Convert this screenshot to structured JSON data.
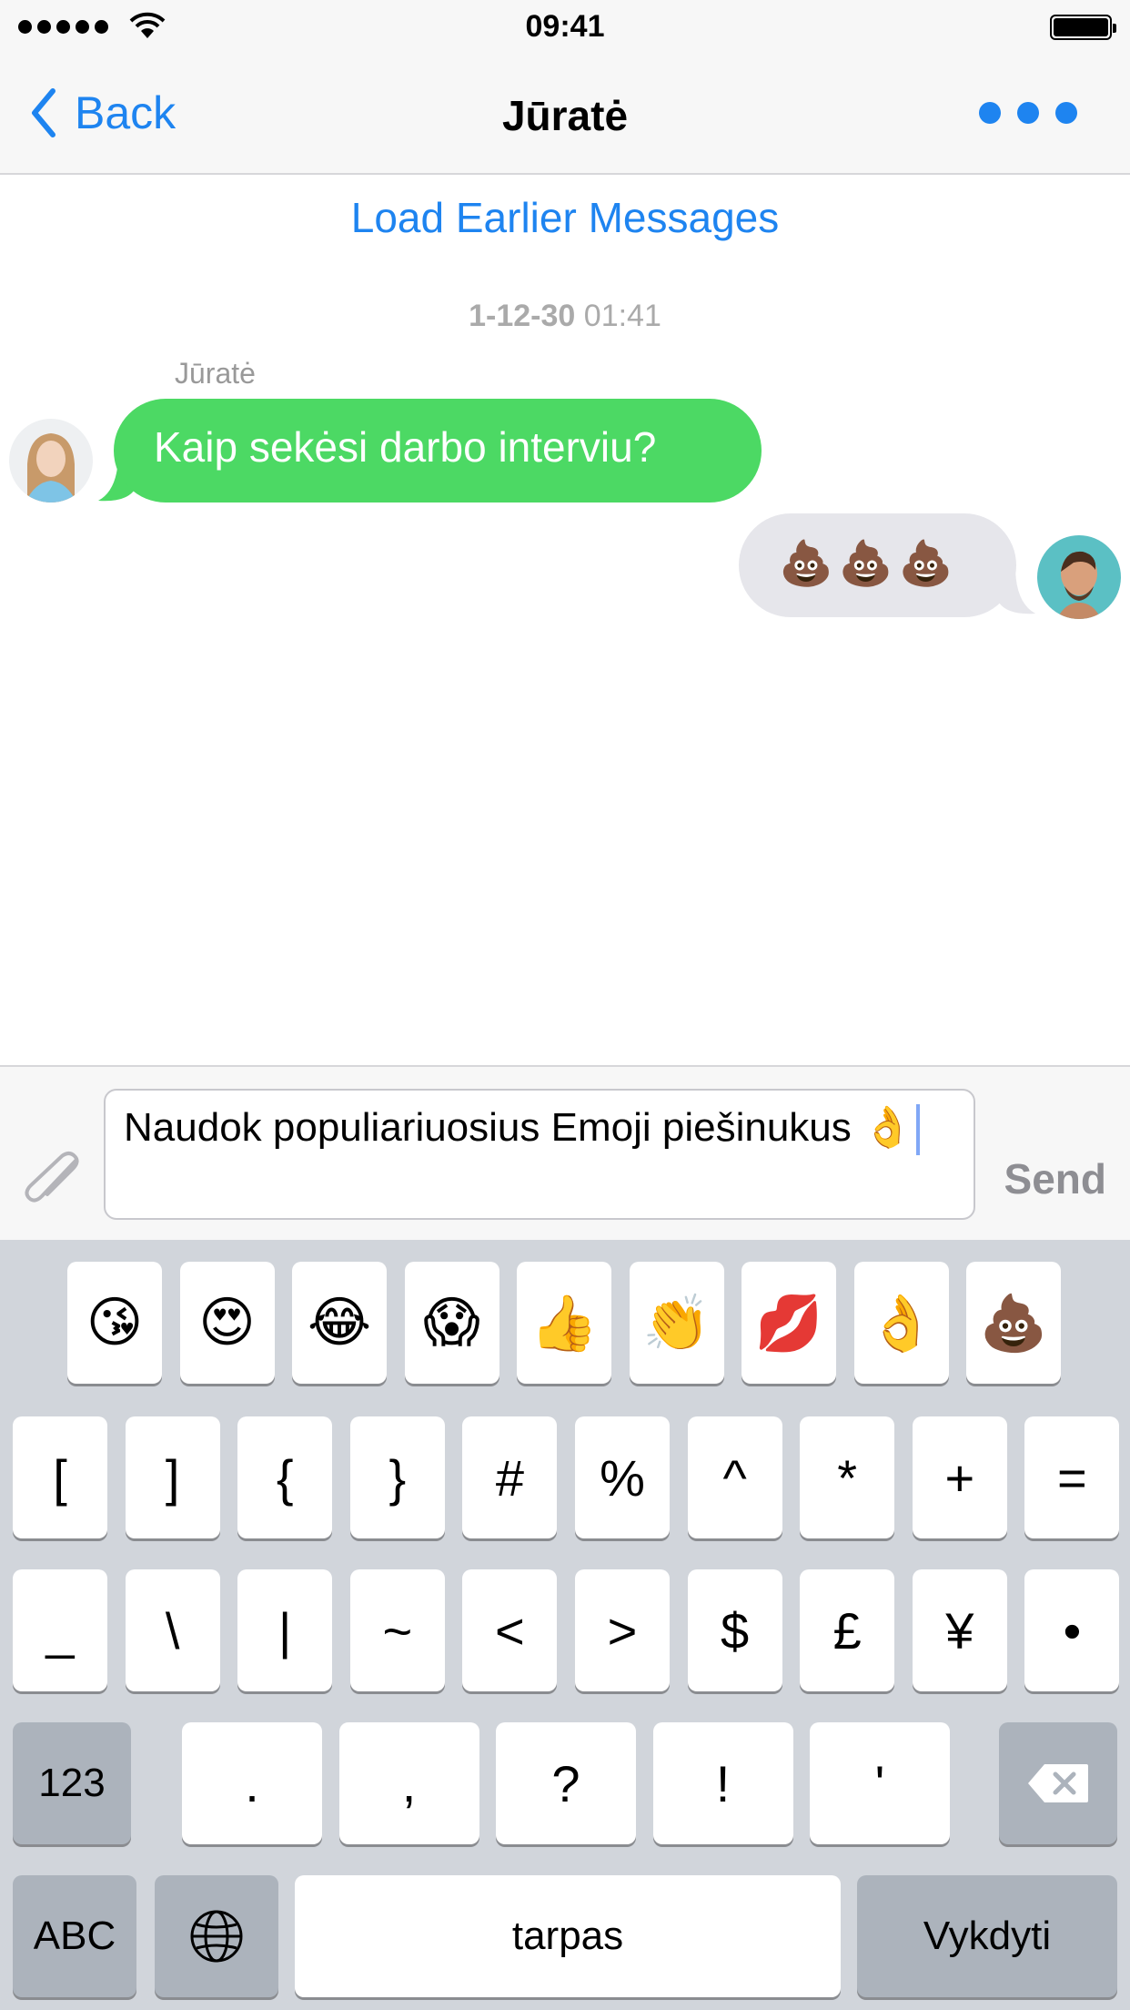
{
  "status": {
    "time": "09:41"
  },
  "nav": {
    "back_label": "Back",
    "title": "Jūratė"
  },
  "chat": {
    "load_earlier": "Load Earlier Messages",
    "day_date": "1-12-30",
    "day_time": "01:41",
    "incoming": {
      "sender": "Jūratė",
      "text": "Kaip sekėsi darbo interviu?"
    },
    "outgoing": {
      "text": "💩💩💩"
    }
  },
  "composer": {
    "text": "Naudok populiariuosius Emoji piešinukus 👌",
    "send_label": "Send"
  },
  "keyboard": {
    "emoji_row": [
      "😘",
      "😍",
      "😂",
      "😱",
      "👍",
      "👏",
      "💋",
      "👌",
      "💩"
    ],
    "row1": [
      "[",
      "]",
      "{",
      "}",
      "#",
      "%",
      "^",
      "*",
      "+",
      "="
    ],
    "row2": [
      "_",
      "\\",
      "|",
      "~",
      "<",
      ">",
      "$",
      "£",
      "¥",
      "•"
    ],
    "row3": {
      "mode": "123",
      "keys": [
        ".",
        ",",
        "?",
        "!",
        "'"
      ]
    },
    "row4": {
      "abc": "ABC",
      "space": "tarpas",
      "return": "Vykdyti"
    }
  }
}
